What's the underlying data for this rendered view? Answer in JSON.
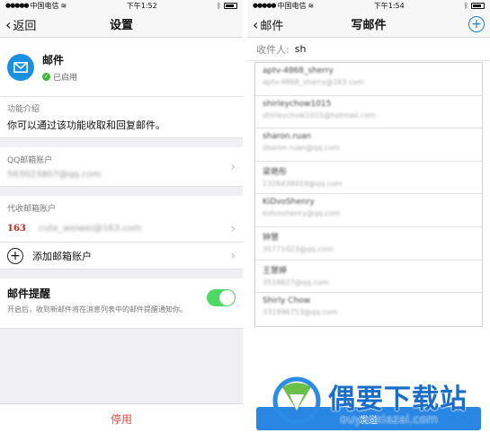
{
  "left": {
    "status": {
      "carrier": "中国电信",
      "time": "下午1:52"
    },
    "nav": {
      "back": "返回",
      "title": "设置"
    },
    "mail": {
      "name": "邮件",
      "status": "已启用"
    },
    "intro": {
      "label": "功能介绍",
      "text": "你可以通过该功能收取和回复邮件。"
    },
    "qq": {
      "label": "QQ邮箱账户",
      "account": "563023807@qq.com"
    },
    "daishou": {
      "label": "代收邮箱账户"
    },
    "acct163": {
      "logo": "163",
      "account": "cute_weiwei@163.com"
    },
    "add": {
      "label": "添加邮箱账户"
    },
    "reminder": {
      "title": "邮件提醒",
      "desc": "开启后，收到新邮件将在消息列表中的邮件提醒通知你。",
      "on": true
    },
    "disable": "停用"
  },
  "right": {
    "status": {
      "carrier": "中国电信",
      "time": "下午1:54"
    },
    "nav": {
      "back": "邮件",
      "title": "写邮件",
      "add": "+"
    },
    "to": {
      "label": "收件人:",
      "value": "sh"
    },
    "suggestions": [
      {
        "name": "aptv-4868_sherry",
        "email": "aptv-4868_sherry@163.com"
      },
      {
        "name": "shirleychow1015",
        "email": "shirleychow1015@hotmail.com"
      },
      {
        "name": "sharon.ruan",
        "email": "sharon.ruan@qq.com"
      },
      {
        "name": "梁艳彤",
        "email": "1326438019@qq.com"
      },
      {
        "name": "KiDvoShenry",
        "email": "kidvoshenry@qq.com"
      },
      {
        "name": "钟慧",
        "email": "35771023@qq.com"
      },
      {
        "name": "王慧婷",
        "email": "3518627@qq.com"
      },
      {
        "name": "Shirly Chow",
        "email": "331996753@qq.com"
      }
    ],
    "send": "发送"
  },
  "watermark": {
    "brand": "偶要下载站",
    "url": "ouyaoxiazai.com"
  },
  "colors": {
    "accent": "#1a82d6",
    "toggle": "#4cd964",
    "danger": "#e0483e",
    "mail": "#1a90e0"
  }
}
